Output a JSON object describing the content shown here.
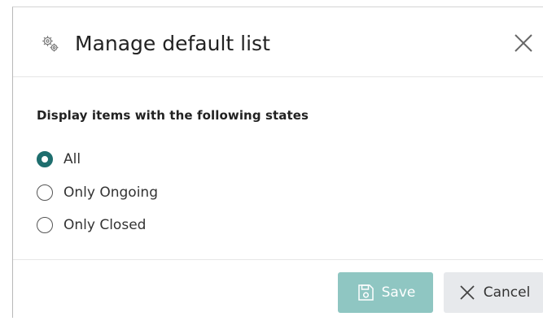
{
  "dialog": {
    "title": "Manage default list",
    "title_icon": "gears-icon",
    "close_icon": "close-icon"
  },
  "filter": {
    "section_label": "Display items with the following states",
    "options": [
      {
        "label": "All",
        "selected": true
      },
      {
        "label": "Only Ongoing",
        "selected": false
      },
      {
        "label": "Only Closed",
        "selected": false
      }
    ]
  },
  "footer": {
    "save_label": "Save",
    "save_icon": "floppy-disk-icon",
    "cancel_label": "Cancel",
    "cancel_icon": "close-icon"
  },
  "colors": {
    "accent": "#1e6e6e",
    "save_button_bg": "#8fc6c2",
    "cancel_button_bg": "#e7e9ec"
  }
}
